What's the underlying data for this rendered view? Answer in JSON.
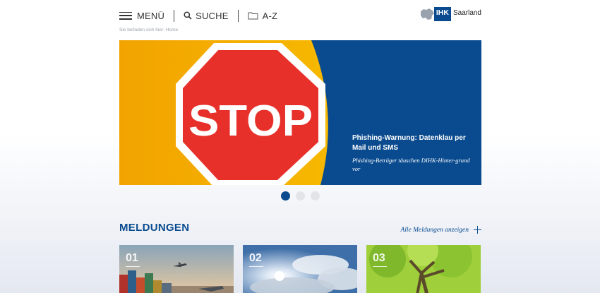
{
  "header": {
    "menu_label": "MENÜ",
    "search_label": "SUCHE",
    "az_label": "A-Z",
    "logo_ihk": "IHK",
    "logo_region": "Saarland"
  },
  "breadcrumb": "Sie befinden sich hier: Home",
  "hero": {
    "sign_text": "STOP",
    "title": "Phishing-Warnung: Datenklau per Mail und SMS",
    "subtitle": "Phishing-Betrüger täuschen DIHK-Hinter-grund vor",
    "slides_total": 3,
    "active_slide": 1
  },
  "news": {
    "section_title": "MELDUNGEN",
    "all_link": "Alle Meldungen anzeigen",
    "cards": [
      {
        "number": "01"
      },
      {
        "number": "02"
      },
      {
        "number": "03"
      }
    ]
  },
  "colors": {
    "brand_blue": "#0a4b8f",
    "stop_red": "#e8302b",
    "hero_yellow": "#f2b100"
  }
}
